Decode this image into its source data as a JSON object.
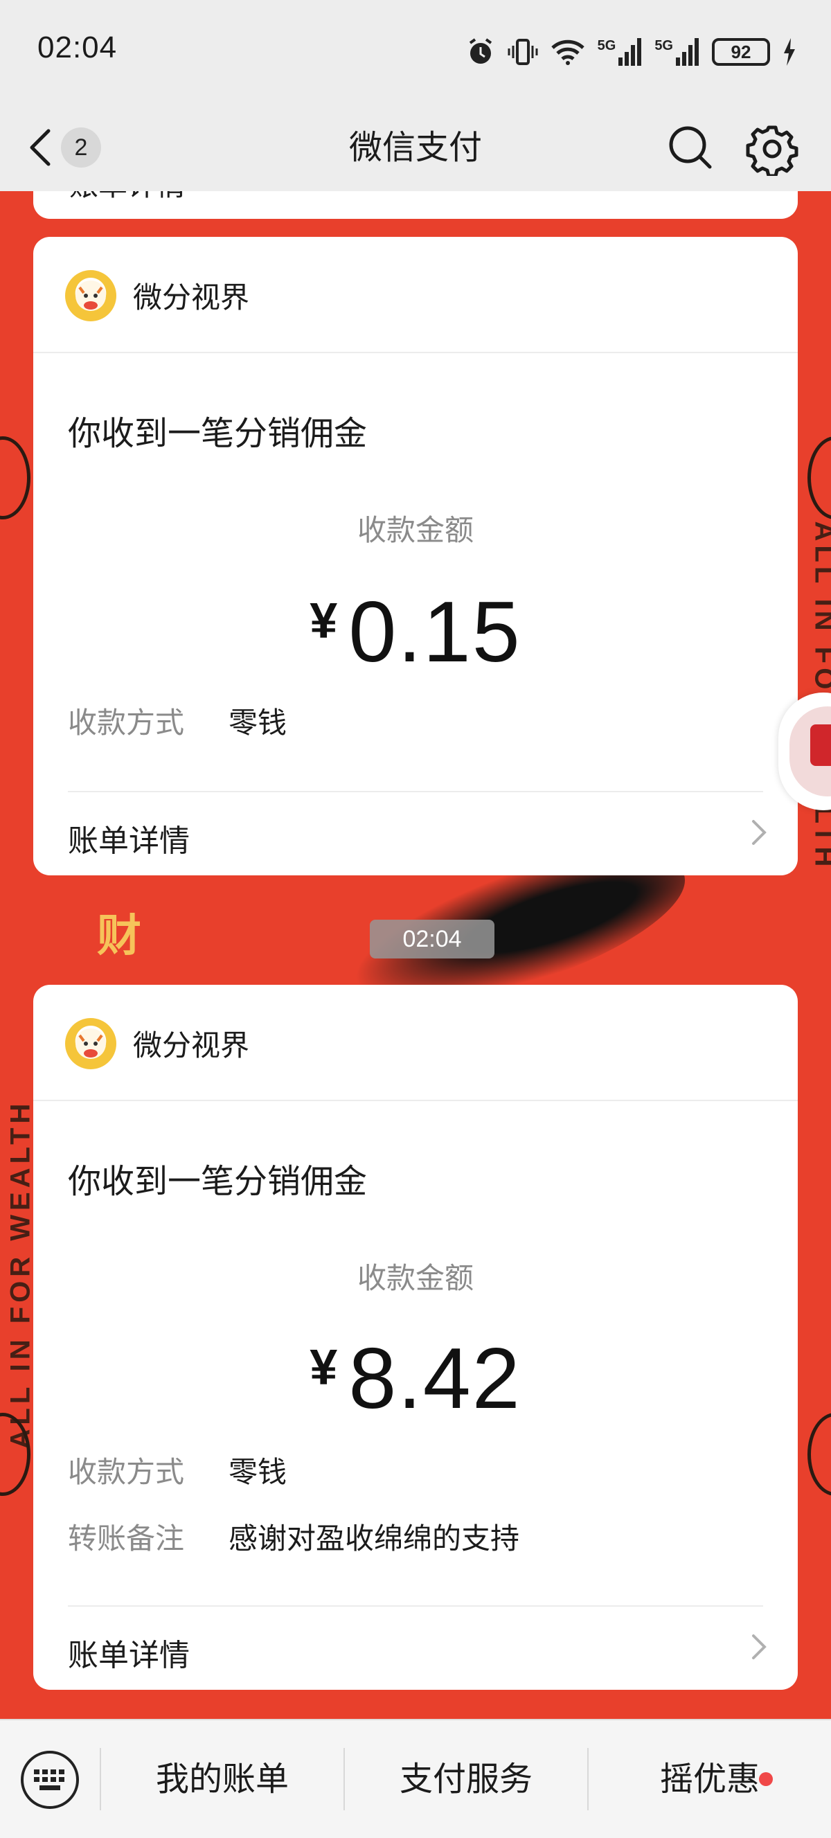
{
  "status_bar": {
    "time": "02:04",
    "battery": "92",
    "network_label_1": "5G",
    "network_label_2": "5G"
  },
  "header": {
    "back_count": "2",
    "title": "微信支付"
  },
  "top_remnant": {
    "partial_label": "账单详情"
  },
  "messages": [
    {
      "merchant": "微分视界",
      "title": "你收到一笔分销佣金",
      "amount_label": "收款金额",
      "currency": "¥",
      "amount": "0.15",
      "fields": [
        {
          "label": "收款方式",
          "value": "零钱"
        }
      ],
      "detail_label": "账单详情"
    },
    {
      "merchant": "微分视界",
      "title": "你收到一笔分销佣金",
      "amount_label": "收款金额",
      "currency": "¥",
      "amount": "8.42",
      "fields": [
        {
          "label": "收款方式",
          "value": "零钱"
        },
        {
          "label": "转账备注",
          "value": "感谢对盈收绵绵的支持"
        }
      ],
      "detail_label": "账单详情"
    }
  ],
  "time_badge": "02:04",
  "background": {
    "slogan": "ALL IN FOR WEALTH",
    "character": "财",
    "accent_color": "#e8402c"
  },
  "bottom_menu": [
    {
      "label": "我的账单"
    },
    {
      "label": "支付服务"
    },
    {
      "label": "摇优惠"
    }
  ]
}
